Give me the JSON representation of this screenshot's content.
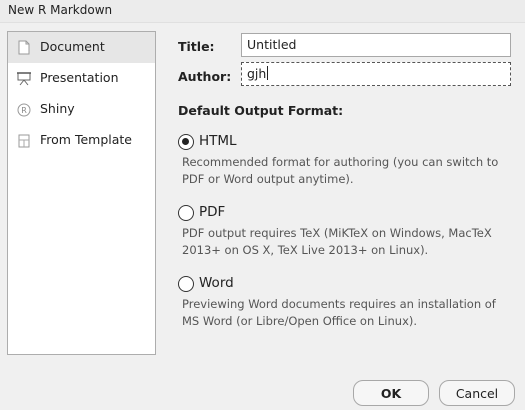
{
  "window": {
    "title": "New R Markdown"
  },
  "sidebar": {
    "items": [
      {
        "label": "Document",
        "icon": "document-icon",
        "selected": true
      },
      {
        "label": "Presentation",
        "icon": "presentation-icon",
        "selected": false
      },
      {
        "label": "Shiny",
        "icon": "shiny-icon",
        "selected": false
      },
      {
        "label": "From Template",
        "icon": "template-icon",
        "selected": false
      }
    ]
  },
  "form": {
    "title_label": "Title:",
    "title_value": "Untitled",
    "author_label": "Author:",
    "author_value": "gjh"
  },
  "output": {
    "heading": "Default Output Format:",
    "options": [
      {
        "label": "HTML",
        "checked": true,
        "description": "Recommended format for authoring (you can switch to PDF or Word output anytime)."
      },
      {
        "label": "PDF",
        "checked": false,
        "description": "PDF output requires TeX (MiKTeX on Windows, MacTeX 2013+ on OS X, TeX Live 2013+ on Linux)."
      },
      {
        "label": "Word",
        "checked": false,
        "description": "Previewing Word documents requires an installation of MS Word (or Libre/Open Office on Linux)."
      }
    ]
  },
  "buttons": {
    "ok": "OK",
    "cancel": "Cancel"
  }
}
